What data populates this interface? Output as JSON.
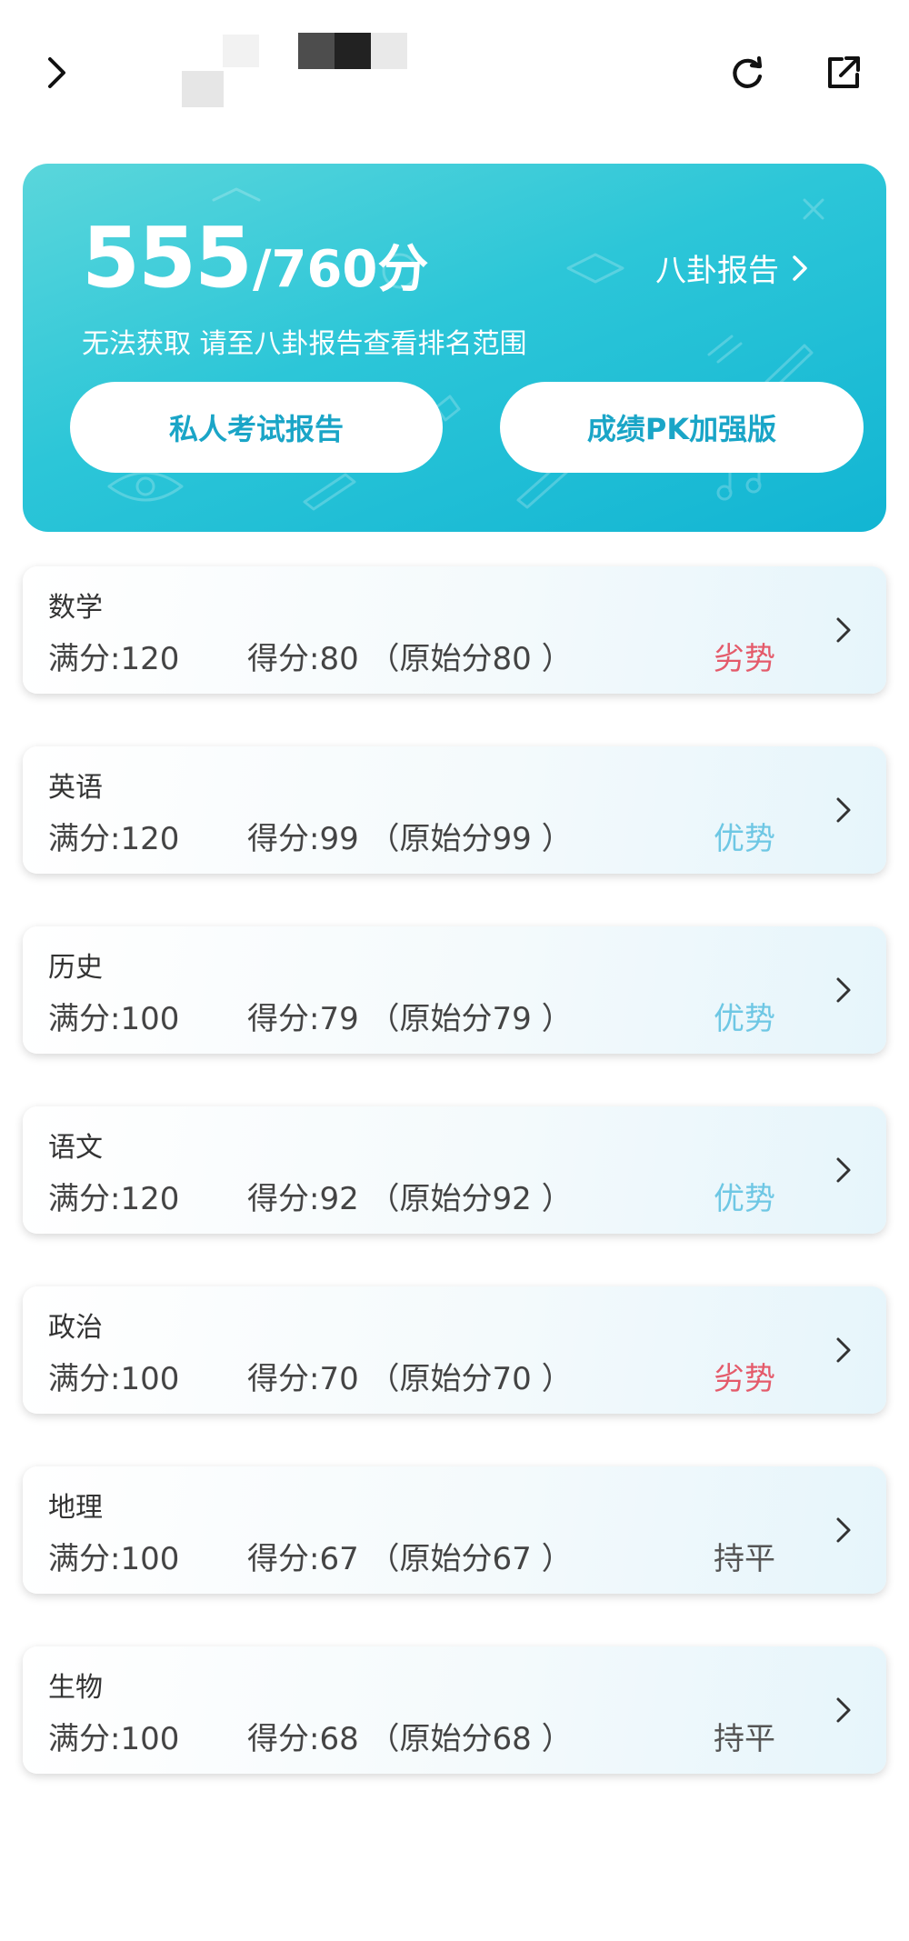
{
  "nav": {
    "back_icon": "chevron-right-icon",
    "refresh_icon": "refresh-icon",
    "share_icon": "share-external-icon"
  },
  "banner": {
    "score": "555",
    "total": "/760分",
    "report_link": "八卦报告",
    "rank_note": "无法获取 请至八卦报告查看排名范围",
    "private_report_button": "私人考试报告",
    "pk_button": "成绩PK加强版"
  },
  "colors": {
    "weak": "#e45b6b",
    "strong": "#6ec7e4",
    "even": "#555555",
    "accent": "#1aa5c7"
  },
  "subjects": [
    {
      "name": "数学",
      "full": "满分:120",
      "score": "得分:80 （原始分80 ）",
      "status": "劣势",
      "status_type": "weak"
    },
    {
      "name": "英语",
      "full": "满分:120",
      "score": "得分:99 （原始分99 ）",
      "status": "优势",
      "status_type": "strong"
    },
    {
      "name": "历史",
      "full": "满分:100",
      "score": "得分:79 （原始分79 ）",
      "status": "优势",
      "status_type": "strong"
    },
    {
      "name": "语文",
      "full": "满分:120",
      "score": "得分:92 （原始分92 ）",
      "status": "优势",
      "status_type": "strong"
    },
    {
      "name": "政治",
      "full": "满分:100",
      "score": "得分:70 （原始分70 ）",
      "status": "劣势",
      "status_type": "weak"
    },
    {
      "name": "地理",
      "full": "满分:100",
      "score": "得分:67 （原始分67 ）",
      "status": "持平",
      "status_type": "even"
    },
    {
      "name": "生物",
      "full": "满分:100",
      "score": "得分:68 （原始分68 ）",
      "status": "持平",
      "status_type": "even"
    }
  ]
}
